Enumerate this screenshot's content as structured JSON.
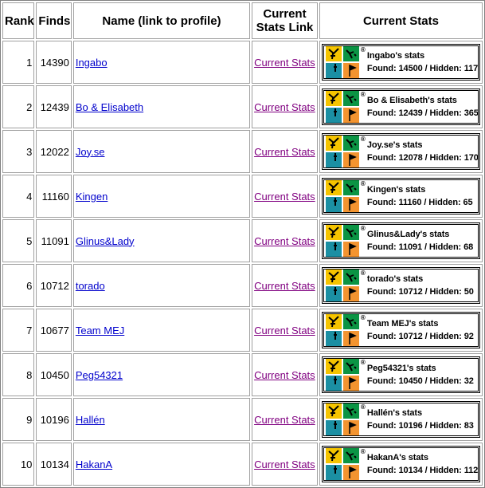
{
  "headers": {
    "rank": "Rank",
    "finds": "Finds",
    "name": "Name (link to profile)",
    "link_line1": "Current",
    "link_line2": "Stats Link",
    "stats": "Current Stats"
  },
  "colors": {
    "logo_yellow": "#f5c400",
    "logo_green": "#0b9444",
    "logo_teal": "#1b8fa3",
    "logo_orange": "#f39430",
    "link_blue": "#0000cc",
    "visited_purple": "#800080"
  },
  "icons": {
    "logo": "geocaching-logo-icon"
  },
  "rows": [
    {
      "rank": "1",
      "finds": "14390",
      "name": "Ingabo",
      "link": "Current Stats",
      "stats_title": "Ingabo's stats",
      "found_label": "Found: ",
      "found": "14500",
      "hidden_label": " / Hidden: ",
      "hidden": "117",
      "reg": "®"
    },
    {
      "rank": "2",
      "finds": "12439",
      "name": "Bo & Elisabeth",
      "link": "Current Stats",
      "stats_title": "Bo & Elisabeth's stats",
      "found_label": "Found: ",
      "found": "12439",
      "hidden_label": " / Hidden: ",
      "hidden": "365",
      "reg": "®"
    },
    {
      "rank": "3",
      "finds": "12022",
      "name": "Joy.se",
      "link": "Current Stats",
      "stats_title": "Joy.se's stats",
      "found_label": "Found: ",
      "found": "12078",
      "hidden_label": " / Hidden: ",
      "hidden": "170",
      "reg": "®"
    },
    {
      "rank": "4",
      "finds": "11160",
      "name": "Kingen",
      "link": "Current Stats",
      "stats_title": "Kingen's stats",
      "found_label": "Found: ",
      "found": "11160",
      "hidden_label": " / Hidden: ",
      "hidden": "65",
      "reg": "®"
    },
    {
      "rank": "5",
      "finds": "11091",
      "name": "Glinus&Lady",
      "link": "Current Stats",
      "stats_title": "Glinus&Lady's stats",
      "found_label": "Found: ",
      "found": "11091",
      "hidden_label": " / Hidden: ",
      "hidden": "68",
      "reg": "®"
    },
    {
      "rank": "6",
      "finds": "10712",
      "name": "torado",
      "link": "Current Stats",
      "stats_title": "torado's stats",
      "found_label": "Found: ",
      "found": "10712",
      "hidden_label": " / Hidden: ",
      "hidden": "50",
      "reg": "®"
    },
    {
      "rank": "7",
      "finds": "10677",
      "name": "Team MEJ",
      "link": "Current Stats",
      "stats_title": "Team MEJ's stats",
      "found_label": "Found: ",
      "found": "10712",
      "hidden_label": " / Hidden: ",
      "hidden": "92",
      "reg": "®"
    },
    {
      "rank": "8",
      "finds": "10450",
      "name": "Peg54321",
      "link": "Current Stats",
      "stats_title": "Peg54321's stats",
      "found_label": "Found: ",
      "found": "10450",
      "hidden_label": " / Hidden: ",
      "hidden": "32",
      "reg": "®"
    },
    {
      "rank": "9",
      "finds": "10196",
      "name": "Hallén",
      "link": "Current Stats",
      "stats_title": "Hallén's stats",
      "found_label": "Found: ",
      "found": "10196",
      "hidden_label": " / Hidden: ",
      "hidden": "83",
      "reg": "®"
    },
    {
      "rank": "10",
      "finds": "10134",
      "name": "HakanA",
      "link": "Current Stats",
      "stats_title": "HakanA's stats",
      "found_label": "Found: ",
      "found": "10134",
      "hidden_label": " / Hidden: ",
      "hidden": "112",
      "reg": "®"
    }
  ]
}
